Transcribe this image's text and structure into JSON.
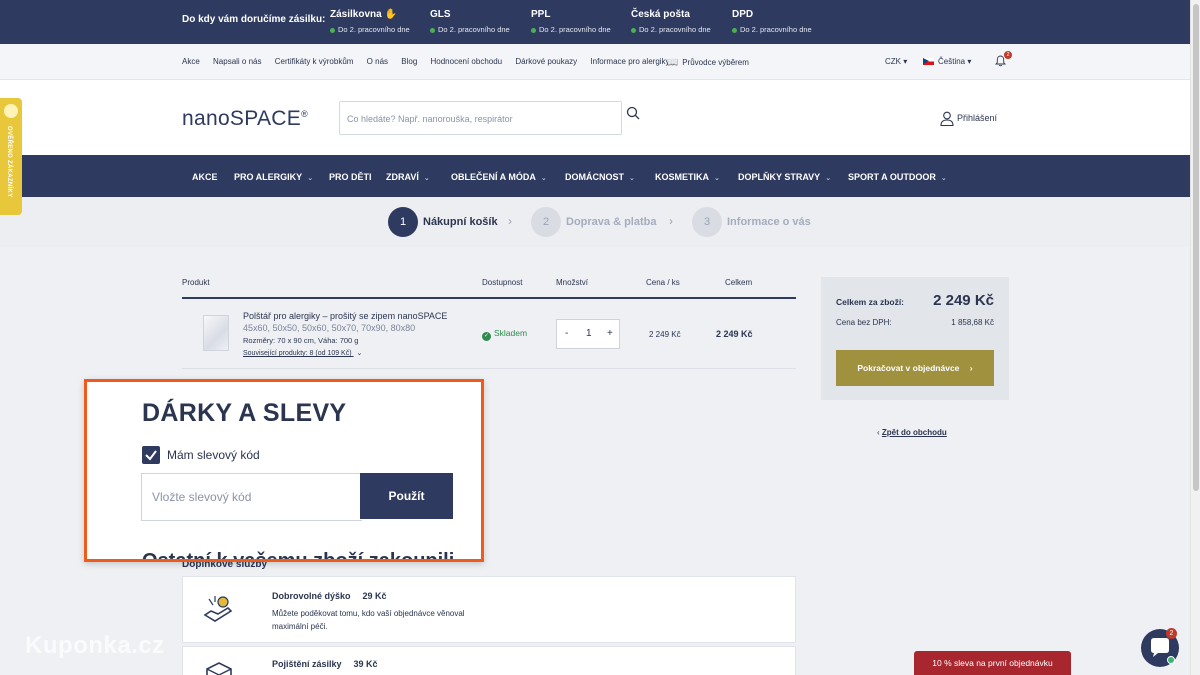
{
  "delivery": {
    "title": "Do kdy vám doručíme zásilku:",
    "carriers": [
      {
        "name": "Zásilkovna",
        "days": "Do 2. pracovního dne"
      },
      {
        "name": "GLS",
        "days": "Do 2. pracovního dne"
      },
      {
        "name": "PPL",
        "days": "Do 2. pracovního dne"
      },
      {
        "name": "Česká pošta",
        "days": "Do 2. pracovního dne"
      },
      {
        "name": "DPD",
        "days": "Do 2. pracovního dne"
      }
    ]
  },
  "secondary_nav": {
    "links": [
      "Akce",
      "Napsali o nás",
      "Certifikáty k výrobkům",
      "O nás",
      "Blog",
      "Hodnocení obchodu",
      "Dárkové poukazy",
      "Informace pro alergiky"
    ],
    "guide": "Průvodce výběrem",
    "currency": "CZK",
    "language": "Čeština",
    "notifications": "2"
  },
  "header": {
    "logo": "nanoSPACE",
    "logo_mark": "®",
    "search_placeholder": "Co hledáte? Např. nanorouška, respirátor",
    "login": "Přihlášení"
  },
  "main_nav": [
    "AKCE",
    "PRO ALERGIKY",
    "PRO DĚTI",
    "ZDRAVÍ",
    "OBLEČENÍ A MÓDA",
    "DOMÁCNOST",
    "KOSMETIKA",
    "DOPLŇKY STRAVY",
    "SPORT A OUTDOOR"
  ],
  "steps": [
    {
      "num": "1",
      "label": "Nákupní košík"
    },
    {
      "num": "2",
      "label": "Doprava & platba"
    },
    {
      "num": "3",
      "label": "Informace o vás"
    }
  ],
  "cart": {
    "headers": {
      "product": "Produkt",
      "availability": "Dostupnost",
      "quantity": "Množství",
      "unit_price": "Cena / ks",
      "total": "Celkem"
    },
    "item": {
      "name": "Polštář pro alergiky – prošitý se zipem nanoSPACE",
      "sizes": "45x60, 50x50, 50x60, 50x70, 70x90, 80x80",
      "dims": "Rozměry: 70 x 90 cm, Váha: 700 g",
      "related": "Související produkty: 8 (od 109 Kč)",
      "stock": "Skladem",
      "qty_minus": "-",
      "qty": "1",
      "qty_plus": "+",
      "unit_price": "2 249 Kč",
      "total": "2 249 Kč"
    }
  },
  "summary": {
    "total_label": "Celkem za zboží:",
    "total_value": "2 249 Kč",
    "vat_label": "Cena bez DPH:",
    "vat_value": "1 858,68 Kč",
    "continue": "Pokračovat v objednávce",
    "back": "Zpět do obchodu"
  },
  "services": {
    "title": "Doplňkové služby",
    "items": [
      {
        "name": "Dobrovolné dýško",
        "price": "29 Kč",
        "desc": "Můžete poděkovat tomu, kdo vaší objednávce věnoval maximální péči."
      },
      {
        "name": "Pojištění zásilky",
        "price": "39 Kč",
        "desc": ""
      }
    ]
  },
  "popup": {
    "title": "DÁRKY A SLEVY",
    "checkbox_label": "Mám slevový kód",
    "input_placeholder": "Vložte slevový kód",
    "apply": "Použít",
    "cut_text": "Ostatní k vašemu zboží zakoupili"
  },
  "side_badge": "OVĚŘENO ZÁKAZNÍKY",
  "promo": "10 % sleva na první objednávku",
  "chat_badge": "2",
  "watermark": "Kuponka.cz",
  "colors": {
    "navy": "#2e3a5f",
    "gold": "#a0913f",
    "highlight": "#f05a1a",
    "promo": "#a8272f"
  }
}
